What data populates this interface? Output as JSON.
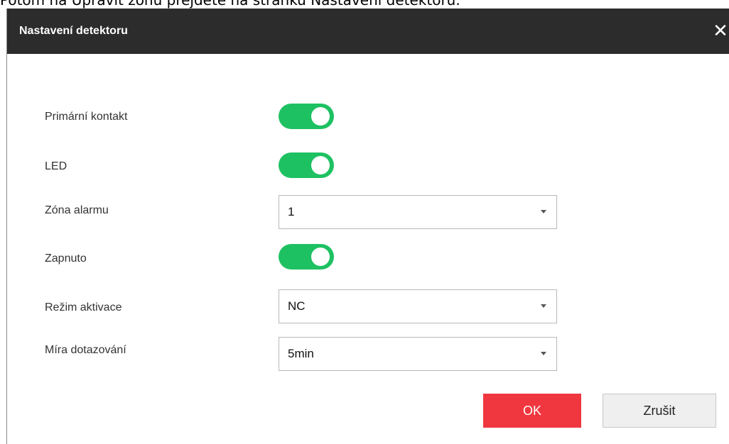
{
  "caption": "Potom na Upravit zónu přejděte na stránku Nastavení detektoru.",
  "dialog": {
    "title": "Nastavení detektoru",
    "close_icon": "close-icon"
  },
  "fields": {
    "primary_contact": {
      "label": "Primární kontakt",
      "enabled": true
    },
    "led": {
      "label": "LED",
      "enabled": true
    },
    "alarm_zone": {
      "label": "Zóna alarmu",
      "value": "1"
    },
    "enabled": {
      "label": "Zapnuto",
      "enabled": true
    },
    "activation_mode": {
      "label": "Režim aktivace",
      "value": "NC"
    },
    "polling_rate": {
      "label": "Míra dotazování",
      "value": "5min"
    }
  },
  "buttons": {
    "ok": "OK",
    "cancel": "Zrušit"
  },
  "colors": {
    "titlebar": "#2c2c2c",
    "toggle_on": "#1ec162",
    "ok_button": "#f0373f"
  }
}
